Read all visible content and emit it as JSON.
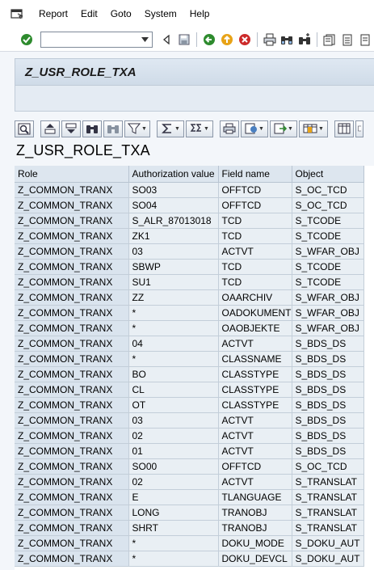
{
  "menu": {
    "items": [
      "Report",
      "Edit",
      "Goto",
      "System",
      "Help"
    ]
  },
  "toolbar": {
    "command_value": ""
  },
  "title": "Z_USR_ROLE_TXA",
  "report_title": "Z_USR_ROLE_TXA",
  "grid": {
    "columns": [
      "Role",
      "Authorization value",
      "Field name",
      "Object"
    ],
    "rows": [
      [
        "Z_COMMON_TRANX",
        "SO03",
        "OFFTCD",
        "S_OC_TCD"
      ],
      [
        "Z_COMMON_TRANX",
        "SO04",
        "OFFTCD",
        "S_OC_TCD"
      ],
      [
        "Z_COMMON_TRANX",
        "S_ALR_87013018",
        "TCD",
        "S_TCODE"
      ],
      [
        "Z_COMMON_TRANX",
        "ZK1",
        "TCD",
        "S_TCODE"
      ],
      [
        "Z_COMMON_TRANX",
        "03",
        "ACTVT",
        "S_WFAR_OBJ"
      ],
      [
        "Z_COMMON_TRANX",
        "SBWP",
        "TCD",
        "S_TCODE"
      ],
      [
        "Z_COMMON_TRANX",
        "SU1",
        "TCD",
        "S_TCODE"
      ],
      [
        "Z_COMMON_TRANX",
        "ZZ",
        "OAARCHIV",
        "S_WFAR_OBJ"
      ],
      [
        "Z_COMMON_TRANX",
        "*",
        "OADOKUMENT",
        "S_WFAR_OBJ"
      ],
      [
        "Z_COMMON_TRANX",
        "*",
        "OAOBJEKTE",
        "S_WFAR_OBJ"
      ],
      [
        "Z_COMMON_TRANX",
        "04",
        "ACTVT",
        "S_BDS_DS"
      ],
      [
        "Z_COMMON_TRANX",
        "*",
        "CLASSNAME",
        "S_BDS_DS"
      ],
      [
        "Z_COMMON_TRANX",
        "BO",
        "CLASSTYPE",
        "S_BDS_DS"
      ],
      [
        "Z_COMMON_TRANX",
        "CL",
        "CLASSTYPE",
        "S_BDS_DS"
      ],
      [
        "Z_COMMON_TRANX",
        "OT",
        "CLASSTYPE",
        "S_BDS_DS"
      ],
      [
        "Z_COMMON_TRANX",
        "03",
        "ACTVT",
        "S_BDS_DS"
      ],
      [
        "Z_COMMON_TRANX",
        "02",
        "ACTVT",
        "S_BDS_DS"
      ],
      [
        "Z_COMMON_TRANX",
        "01",
        "ACTVT",
        "S_BDS_DS"
      ],
      [
        "Z_COMMON_TRANX",
        "SO00",
        "OFFTCD",
        "S_OC_TCD"
      ],
      [
        "Z_COMMON_TRANX",
        "02",
        "ACTVT",
        "S_TRANSLAT"
      ],
      [
        "Z_COMMON_TRANX",
        "E",
        "TLANGUAGE",
        "S_TRANSLAT"
      ],
      [
        "Z_COMMON_TRANX",
        "LONG",
        "TRANOBJ",
        "S_TRANSLAT"
      ],
      [
        "Z_COMMON_TRANX",
        "SHRT",
        "TRANOBJ",
        "S_TRANSLAT"
      ],
      [
        "Z_COMMON_TRANX",
        "*",
        "DOKU_MODE",
        "S_DOKU_AUT"
      ],
      [
        "Z_COMMON_TRANX",
        "*",
        "DOKU_DEVCL",
        "S_DOKU_AUT"
      ]
    ]
  }
}
